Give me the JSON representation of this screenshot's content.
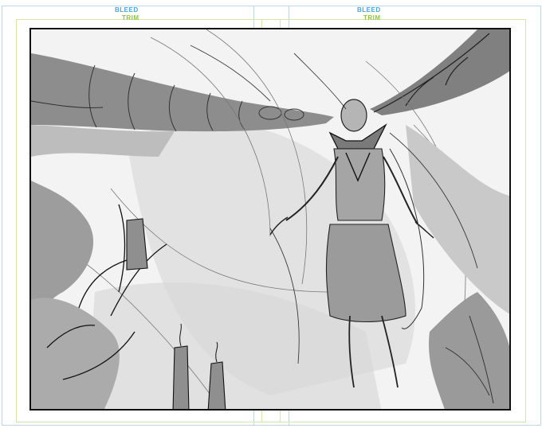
{
  "guides": {
    "left_bleed": "BLEED",
    "left_trim": "TRIM",
    "right_bleed": "BLEED",
    "right_trim": "TRIM"
  },
  "colors": {
    "bleed_label": "#4aa3dc",
    "trim_label": "#8cc63f",
    "bleed_line": "#bcd8e8",
    "trim_line": "#d6e6a4",
    "panel_border": "#111111",
    "sketch_gray": "#9a9a9a",
    "sketch_dark": "#222222"
  },
  "artwork": {
    "subject": "pencil-sketch-figure-floating"
  }
}
